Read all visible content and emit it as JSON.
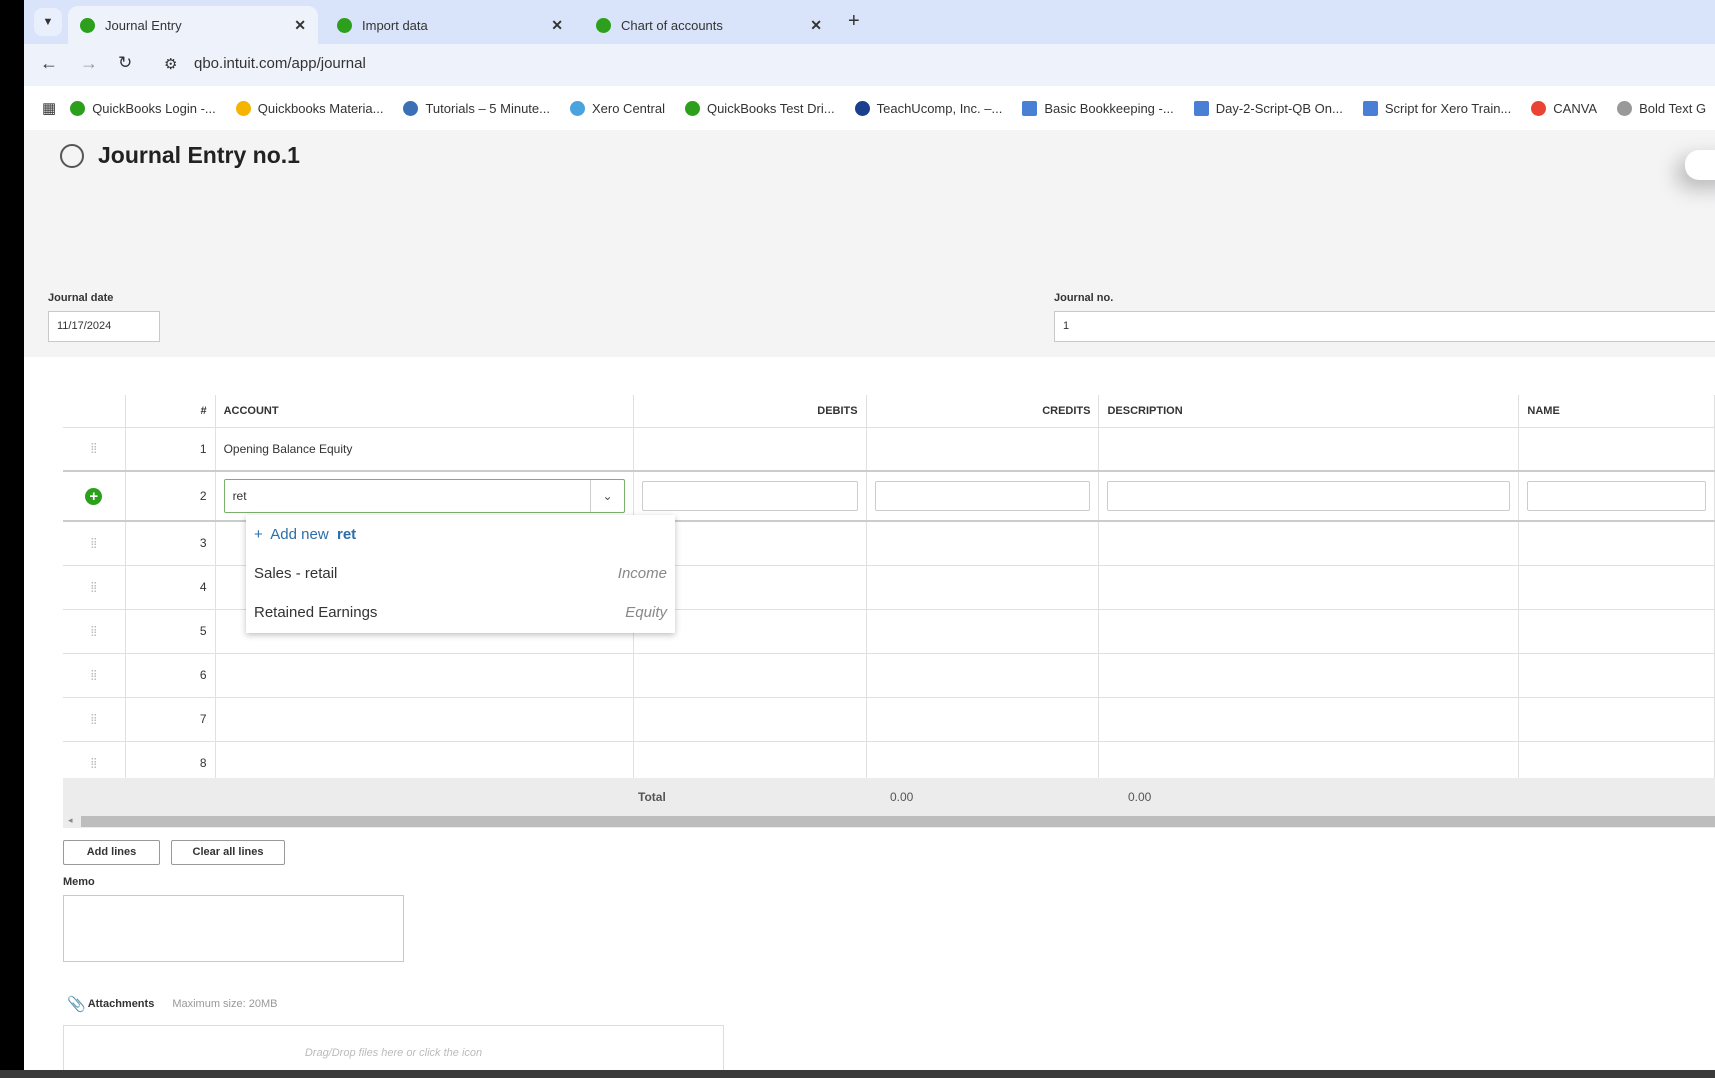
{
  "browser": {
    "tabs": [
      {
        "label": "Journal Entry",
        "active": true
      },
      {
        "label": "Import data",
        "active": false
      },
      {
        "label": "Chart of accounts",
        "active": false
      }
    ],
    "url": "qbo.intuit.com/app/journal",
    "bookmarks": [
      "QuickBooks Login -...",
      "Quickbooks Materia...",
      "Tutorials – 5 Minute...",
      "Xero Central",
      "QuickBooks Test Dri...",
      "TeachUcomp, Inc. –...",
      "Basic Bookkeeping -...",
      "Day-2-Script-QB On...",
      "Script for Xero Train...",
      "CANVA",
      "Bold Text G"
    ]
  },
  "page": {
    "title": "Journal Entry no.1",
    "journal_date_label": "Journal date",
    "journal_date": "11/17/2024",
    "journal_no_label": "Journal no.",
    "journal_no": "1"
  },
  "table": {
    "headers": {
      "num": "#",
      "account": "ACCOUNT",
      "debits": "DEBITS",
      "credits": "CREDITS",
      "description": "DESCRIPTION",
      "name": "NAME"
    },
    "rows": [
      {
        "n": "1",
        "account": "Opening Balance Equity"
      },
      {
        "n": "2",
        "account": "ret"
      },
      {
        "n": "3"
      },
      {
        "n": "4"
      },
      {
        "n": "5"
      },
      {
        "n": "6"
      },
      {
        "n": "7"
      },
      {
        "n": "8"
      }
    ],
    "total_label": "Total",
    "total_debits": "0.00",
    "total_credits": "0.00"
  },
  "dropdown": {
    "add_new": "Add new",
    "query": "ret",
    "options": [
      {
        "label": "Sales - retail",
        "type": "Income"
      },
      {
        "label": "Retained Earnings",
        "type": "Equity"
      }
    ]
  },
  "buttons": {
    "add_lines": "Add lines",
    "clear_all_lines": "Clear all lines"
  },
  "memo": {
    "label": "Memo"
  },
  "attachments": {
    "label": "Attachments",
    "max": "Maximum size: 20MB",
    "drop_hint": "Drag/Drop files here or click the icon"
  }
}
